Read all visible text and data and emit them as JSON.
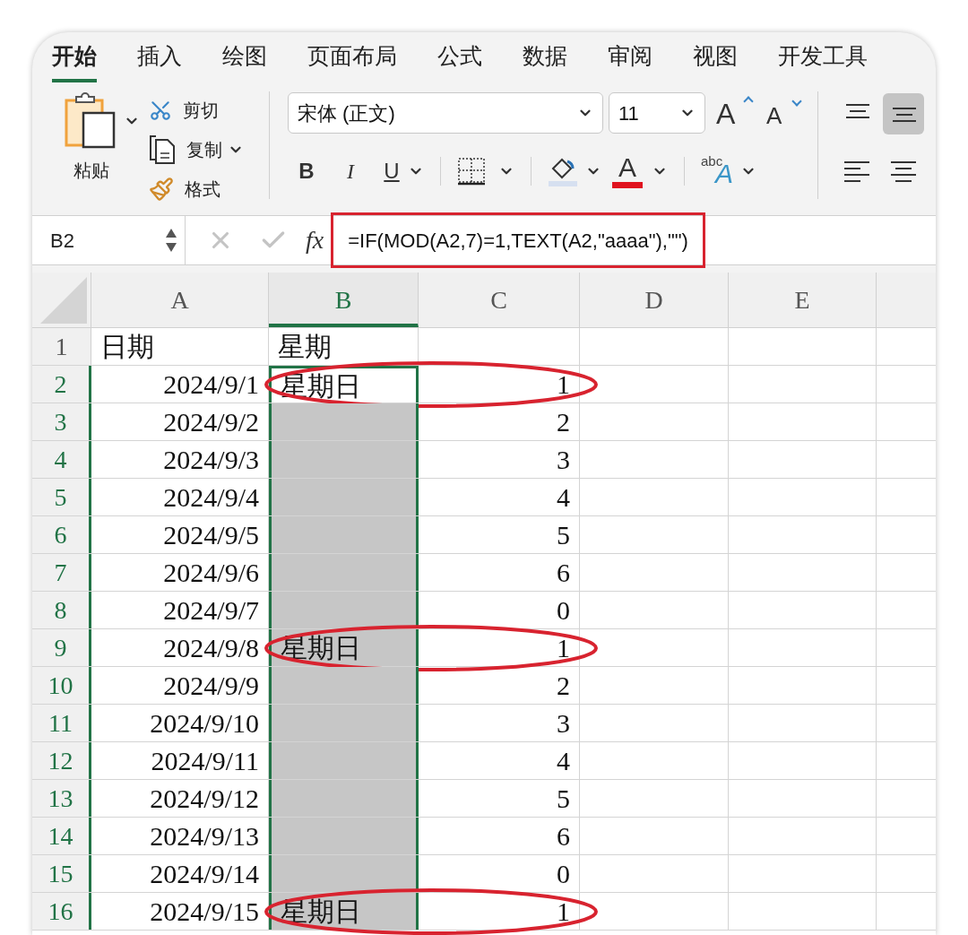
{
  "tabs": [
    {
      "label": "开始",
      "selected": true
    },
    {
      "label": "插入",
      "selected": false
    },
    {
      "label": "绘图",
      "selected": false
    },
    {
      "label": "页面布局",
      "selected": false
    },
    {
      "label": "公式",
      "selected": false
    },
    {
      "label": "数据",
      "selected": false
    },
    {
      "label": "审阅",
      "selected": false
    },
    {
      "label": "视图",
      "selected": false
    },
    {
      "label": "开发工具",
      "selected": false
    }
  ],
  "clipboard": {
    "paste": "粘贴",
    "cut": "剪切",
    "copy": "复制",
    "format_painter": "格式"
  },
  "font": {
    "name": "宋体 (正文)",
    "size": "11",
    "grow": "A",
    "shrink": "A",
    "bold": "B",
    "italic": "I",
    "underline": "U",
    "font_color": "A",
    "effects_small": "abc",
    "effects_big": "A"
  },
  "alignment": [
    {
      "kind": "top",
      "selected": false
    },
    {
      "kind": "middle",
      "selected": true
    },
    {
      "kind": "left",
      "selected": false
    },
    {
      "kind": "center",
      "selected": false
    }
  ],
  "formula_bar": {
    "name_box": "B2",
    "fx": "fx",
    "formula": "=IF(MOD(A2,7)=1,TEXT(A2,\"aaaa\"),\"\")"
  },
  "columns": [
    {
      "label": "A",
      "selected": false
    },
    {
      "label": "B",
      "selected": true
    },
    {
      "label": "C",
      "selected": false
    },
    {
      "label": "D",
      "selected": false
    },
    {
      "label": "E",
      "selected": false
    }
  ],
  "rows": [
    {
      "number": "1",
      "kind": "text",
      "selected": false,
      "active": false,
      "circled": false,
      "a": "日期",
      "b": "星期",
      "c": ""
    },
    {
      "number": "2",
      "kind": "data",
      "selected": true,
      "active": true,
      "circled": true,
      "a": "2024/9/1",
      "b": "星期日",
      "c": "1"
    },
    {
      "number": "3",
      "kind": "data",
      "selected": true,
      "active": false,
      "circled": false,
      "a": "2024/9/2",
      "b": "",
      "c": "2"
    },
    {
      "number": "4",
      "kind": "data",
      "selected": true,
      "active": false,
      "circled": false,
      "a": "2024/9/3",
      "b": "",
      "c": "3"
    },
    {
      "number": "5",
      "kind": "data",
      "selected": true,
      "active": false,
      "circled": false,
      "a": "2024/9/4",
      "b": "",
      "c": "4"
    },
    {
      "number": "6",
      "kind": "data",
      "selected": true,
      "active": false,
      "circled": false,
      "a": "2024/9/5",
      "b": "",
      "c": "5"
    },
    {
      "number": "7",
      "kind": "data",
      "selected": true,
      "active": false,
      "circled": false,
      "a": "2024/9/6",
      "b": "",
      "c": "6"
    },
    {
      "number": "8",
      "kind": "data",
      "selected": true,
      "active": false,
      "circled": false,
      "a": "2024/9/7",
      "b": "",
      "c": "0"
    },
    {
      "number": "9",
      "kind": "data",
      "selected": true,
      "active": false,
      "circled": true,
      "a": "2024/9/8",
      "b": "星期日",
      "c": "1"
    },
    {
      "number": "10",
      "kind": "data",
      "selected": true,
      "active": false,
      "circled": false,
      "a": "2024/9/9",
      "b": "",
      "c": "2"
    },
    {
      "number": "11",
      "kind": "data",
      "selected": true,
      "active": false,
      "circled": false,
      "a": "2024/9/10",
      "b": "",
      "c": "3"
    },
    {
      "number": "12",
      "kind": "data",
      "selected": true,
      "active": false,
      "circled": false,
      "a": "2024/9/11",
      "b": "",
      "c": "4"
    },
    {
      "number": "13",
      "kind": "data",
      "selected": true,
      "active": false,
      "circled": false,
      "a": "2024/9/12",
      "b": "",
      "c": "5"
    },
    {
      "number": "14",
      "kind": "data",
      "selected": true,
      "active": false,
      "circled": false,
      "a": "2024/9/13",
      "b": "",
      "c": "6"
    },
    {
      "number": "15",
      "kind": "data",
      "selected": true,
      "active": false,
      "circled": false,
      "a": "2024/9/14",
      "b": "",
      "c": "0"
    },
    {
      "number": "16",
      "kind": "data",
      "selected": true,
      "active": false,
      "circled": true,
      "a": "2024/9/15",
      "b": "星期日",
      "c": "1"
    }
  ]
}
